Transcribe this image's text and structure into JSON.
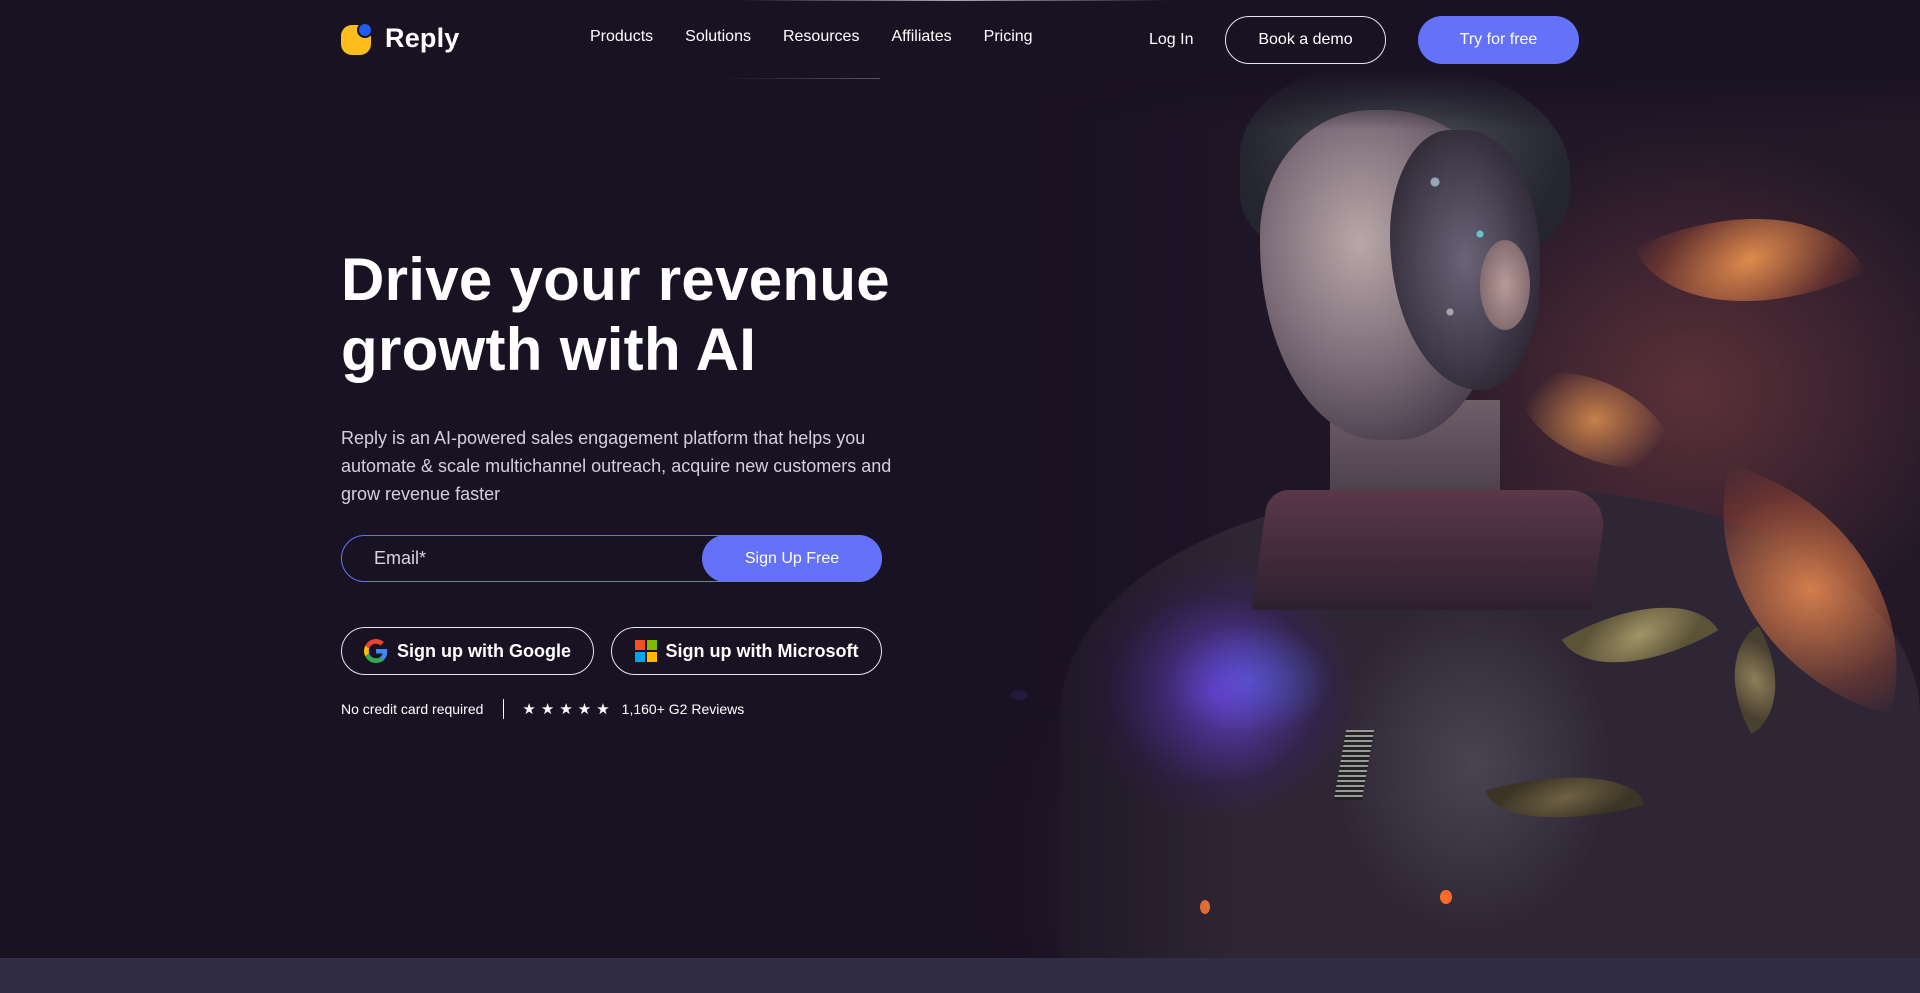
{
  "brand": {
    "name": "Reply",
    "logo_colors": {
      "primary": "#fdbd1c",
      "accent": "#1f5cf2"
    }
  },
  "nav": {
    "links": [
      {
        "label": "Products"
      },
      {
        "label": "Solutions"
      },
      {
        "label": "Resources"
      },
      {
        "label": "Affiliates"
      },
      {
        "label": "Pricing"
      }
    ],
    "login_label": "Log In",
    "demo_label": "Book a demo",
    "try_label": "Try for free"
  },
  "hero": {
    "title_line1": "Drive your revenue",
    "title_line2": "growth with AI",
    "subtitle": "Reply is an AI-powered sales engagement platform that helps you automate & scale multichannel outreach, acquire new customers and grow revenue faster",
    "email_placeholder": "Email*",
    "email_value": "",
    "signup_label": "Sign Up Free",
    "google_label": "Sign up with Google",
    "microsoft_label": "Sign up with Microsoft",
    "no_card_text": "No credit card required",
    "rating_stars": 5,
    "reviews_text": "1,160+ G2 Reviews",
    "image_description": "AI-generated portrait of a man with cybernetic face details surrounded by orange autumn leaves and glowing purple circuitry"
  },
  "colors": {
    "background": "#191222",
    "accent": "#6472fa",
    "footer_strip": "#312e44"
  }
}
